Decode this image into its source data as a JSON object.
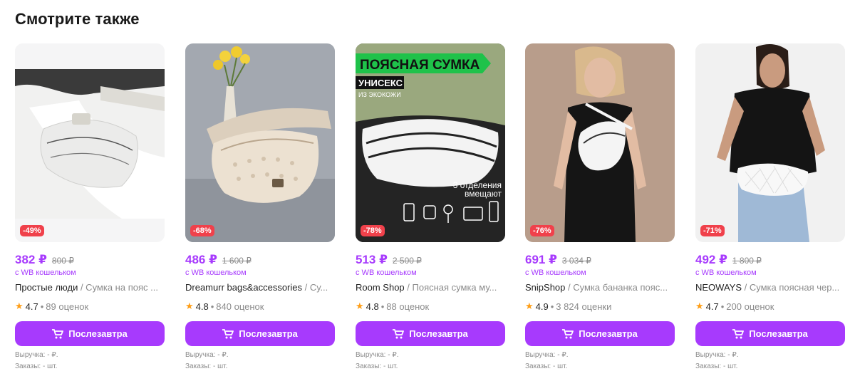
{
  "section_title": "Смотрите также",
  "products": [
    {
      "discount": "-49%",
      "price": "382 ₽",
      "old_price": "800 ₽",
      "wallet_note": "с WB кошельком",
      "brand": "Простые люди",
      "name": " / Сумка на пояс ...",
      "rating": "4.7",
      "reviews": "89 оценок",
      "button_label": "Послезавтра",
      "revenue": "Выручка: - ₽.",
      "orders": "Заказы: - шт.",
      "image_bg": "#f2f2f2",
      "bag_color": "#ececea"
    },
    {
      "discount": "-68%",
      "price": "486 ₽",
      "old_price": "1 600 ₽",
      "wallet_note": "с WB кошельком",
      "brand": "Dreamurr bags&accessories",
      "name": " / Су...",
      "rating": "4.8",
      "reviews": "840 оценок",
      "button_label": "Послезавтра",
      "revenue": "Выручка: - ₽.",
      "orders": "Заказы: - шт.",
      "image_bg": "#9ea4ad",
      "bag_color": "#e9dccb"
    },
    {
      "discount": "-78%",
      "price": "513 ₽",
      "old_price": "2 500 ₽",
      "wallet_note": "с WB кошельком",
      "brand": "Room Shop",
      "name": " / Поясная сумка му...",
      "rating": "4.8",
      "reviews": "88 оценок",
      "button_label": "Послезавтра",
      "revenue": "Выручка: - ₽.",
      "orders": "Заказы: - шт.",
      "image_bg": "#2a2a2a",
      "bag_color": "#f4f4f4",
      "overlay": {
        "headline": "ПОЯСНАЯ СУМКА",
        "tag": "УНИСЕКС",
        "material": "ИЗ ЭКОКОЖИ",
        "note_line1": "3 отделения",
        "note_line2": "вмещают"
      }
    },
    {
      "discount": "-76%",
      "price": "691 ₽",
      "old_price": "3 034 ₽",
      "wallet_note": "с WB кошельком",
      "brand": "SnipShop",
      "name": " / Сумка бананка пояс...",
      "rating": "4.9",
      "reviews": "3 824 оценки",
      "button_label": "Послезавтра",
      "revenue": "Выручка: - ₽.",
      "orders": "Заказы: - шт.",
      "image_bg": "#b69a88",
      "bag_color": "#f2f2f2"
    },
    {
      "discount": "-71%",
      "price": "492 ₽",
      "old_price": "1 800 ₽",
      "wallet_note": "с WB кошельком",
      "brand": "NEOWAYS",
      "name": " / Сумка поясная чер...",
      "rating": "4.7",
      "reviews": "200 оценок",
      "button_label": "Послезавтра",
      "revenue": "Выручка: - ₽.",
      "orders": "Заказы: - шт.",
      "image_bg": "#f1f1f1",
      "bag_color": "#f7f7f7"
    }
  ],
  "icons": {
    "star": "star-icon",
    "cart": "cart-icon"
  },
  "colors": {
    "accent": "#a73afd",
    "discount_badge": "#f0414b",
    "star": "#ff9e16"
  }
}
